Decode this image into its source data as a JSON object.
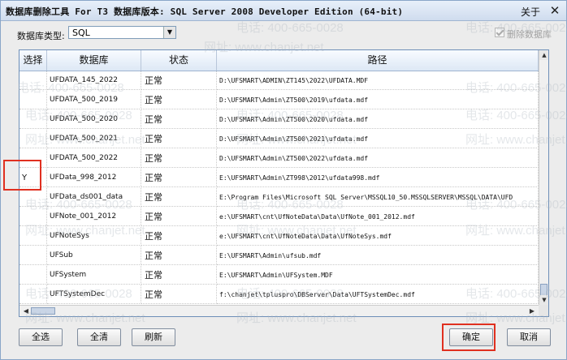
{
  "window": {
    "title": "数据库删除工具 For T3 数据库版本: SQL Server 2008  Developer Edition (64-bit)",
    "about_label": "关于",
    "close_glyph": "✕"
  },
  "toolbar": {
    "db_type_label": "数据库类型:",
    "db_type_value": "SQL",
    "delete_db_label": "删除数据库",
    "delete_db_checked": true
  },
  "grid": {
    "columns": [
      "选择",
      "数据库",
      "状态",
      "路径"
    ],
    "rows": [
      {
        "select": "",
        "db": "UFDATA_145_2022",
        "status": "正常",
        "path": "D:\\UFSMART\\ADMIN\\ZT145\\2022\\UFDATA.MDF"
      },
      {
        "select": "",
        "db": "UFDATA_500_2019",
        "status": "正常",
        "path": "D:\\UFSMART\\Admin\\ZT500\\2019\\ufdata.mdf"
      },
      {
        "select": "",
        "db": "UFDATA_500_2020",
        "status": "正常",
        "path": "D:\\UFSMART\\Admin\\ZT500\\2020\\ufdata.mdf"
      },
      {
        "select": "",
        "db": "UFDATA_500_2021",
        "status": "正常",
        "path": "D:\\UFSMART\\Admin\\ZT500\\2021\\ufdata.mdf"
      },
      {
        "select": "",
        "db": "UFDATA_500_2022",
        "status": "正常",
        "path": "D:\\UFSMART\\Admin\\ZT500\\2022\\ufdata.mdf"
      },
      {
        "select": "Y",
        "db": "UFData_998_2012",
        "status": "正常",
        "path": "E:\\UFSMART\\Admin\\ZT998\\2012\\ufdata998.mdf"
      },
      {
        "select": "",
        "db": "UFData_ds001_data",
        "status": "正常",
        "path": "E:\\Program Files\\Microsoft SQL Server\\MSSQL10_50.MSSQLSERVER\\MSSQL\\DATA\\UFD"
      },
      {
        "select": "",
        "db": "UFNote_001_2012",
        "status": "正常",
        "path": "e:\\UFSMART\\cnt\\UfNoteData\\Data\\UfNote_001_2012.mdf"
      },
      {
        "select": "",
        "db": "UFNoteSys",
        "status": "正常",
        "path": "e:\\UFSMART\\cnt\\UfNoteData\\Data\\UfNoteSys.mdf"
      },
      {
        "select": "",
        "db": "UFSub",
        "status": "正常",
        "path": "E:\\UFSMART\\Admin\\ufsub.mdf"
      },
      {
        "select": "",
        "db": "UFSystem",
        "status": "正常",
        "path": "E:\\UFSMART\\Admin\\UFSystem.MDF"
      },
      {
        "select": "",
        "db": "UFTSystemDec",
        "status": "正常",
        "path": "f:\\chanjet\\tpluspro\\DBServer\\Data\\UFTSystemDec.mdf"
      }
    ]
  },
  "buttons": {
    "select_all": "全选",
    "clear_all": "全清",
    "refresh": "刷新",
    "ok": "确定",
    "cancel": "取消"
  },
  "watermarks": [
    "电话: 400-665-0028",
    "网址: www.chanjet.net"
  ],
  "colors": {
    "highlight": "#e03020",
    "title_bar": "#dbe6f4",
    "grid_border": "#6e8fb8"
  }
}
